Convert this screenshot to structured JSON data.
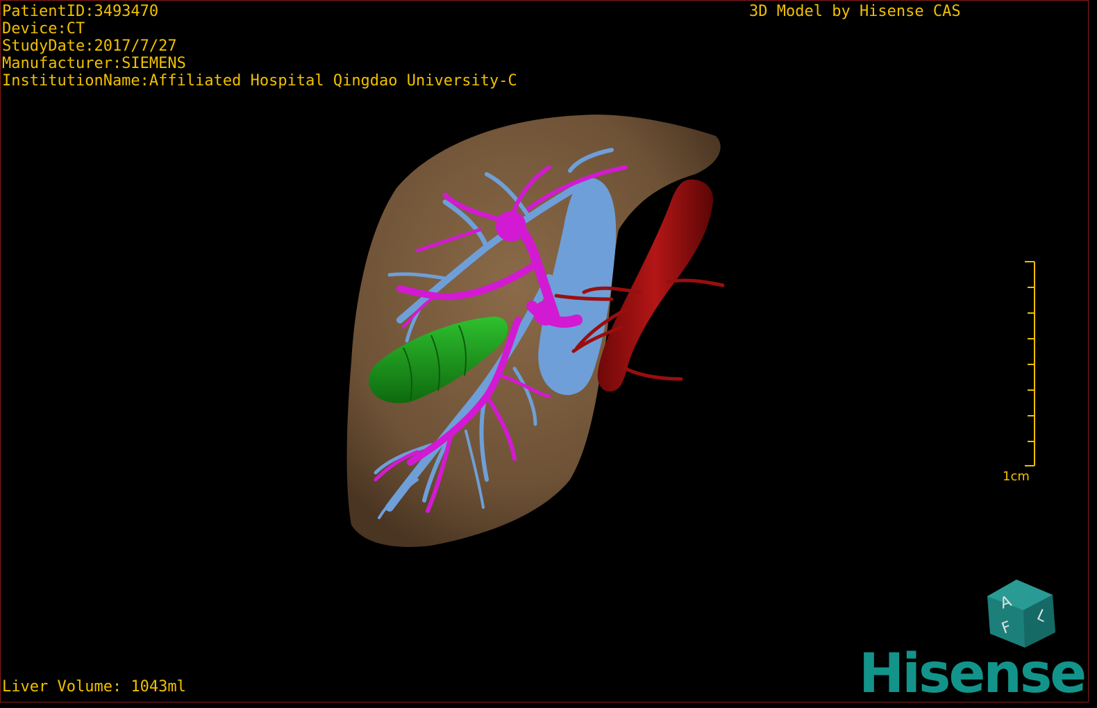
{
  "overlay": {
    "patient_id": "PatientID:3493470",
    "device": "Device:CT",
    "study_date": "StudyDate:2017/7/27",
    "manufacturer": "Manufacturer:SIEMENS",
    "institution": "InstitutionName:Affiliated Hospital Qingdao University-C",
    "credit": "3D Model by Hisense CAS",
    "liver_volume": "Liver Volume: 1043ml"
  },
  "scale": {
    "label": "1cm",
    "ticks": 9
  },
  "orientation_cube": {
    "face_labels": [
      "A",
      "F",
      "L"
    ]
  },
  "logo": {
    "text": "Hisense"
  },
  "colors": {
    "overlay_text": "#f0c000",
    "liver": "#7a5c3e",
    "hepatic_vein": "#6f9fd8",
    "portal_vein": "#d21ad2",
    "tumor": "#1a9a1a",
    "ivc_aorta": "#a81010",
    "brand": "#13948a"
  }
}
